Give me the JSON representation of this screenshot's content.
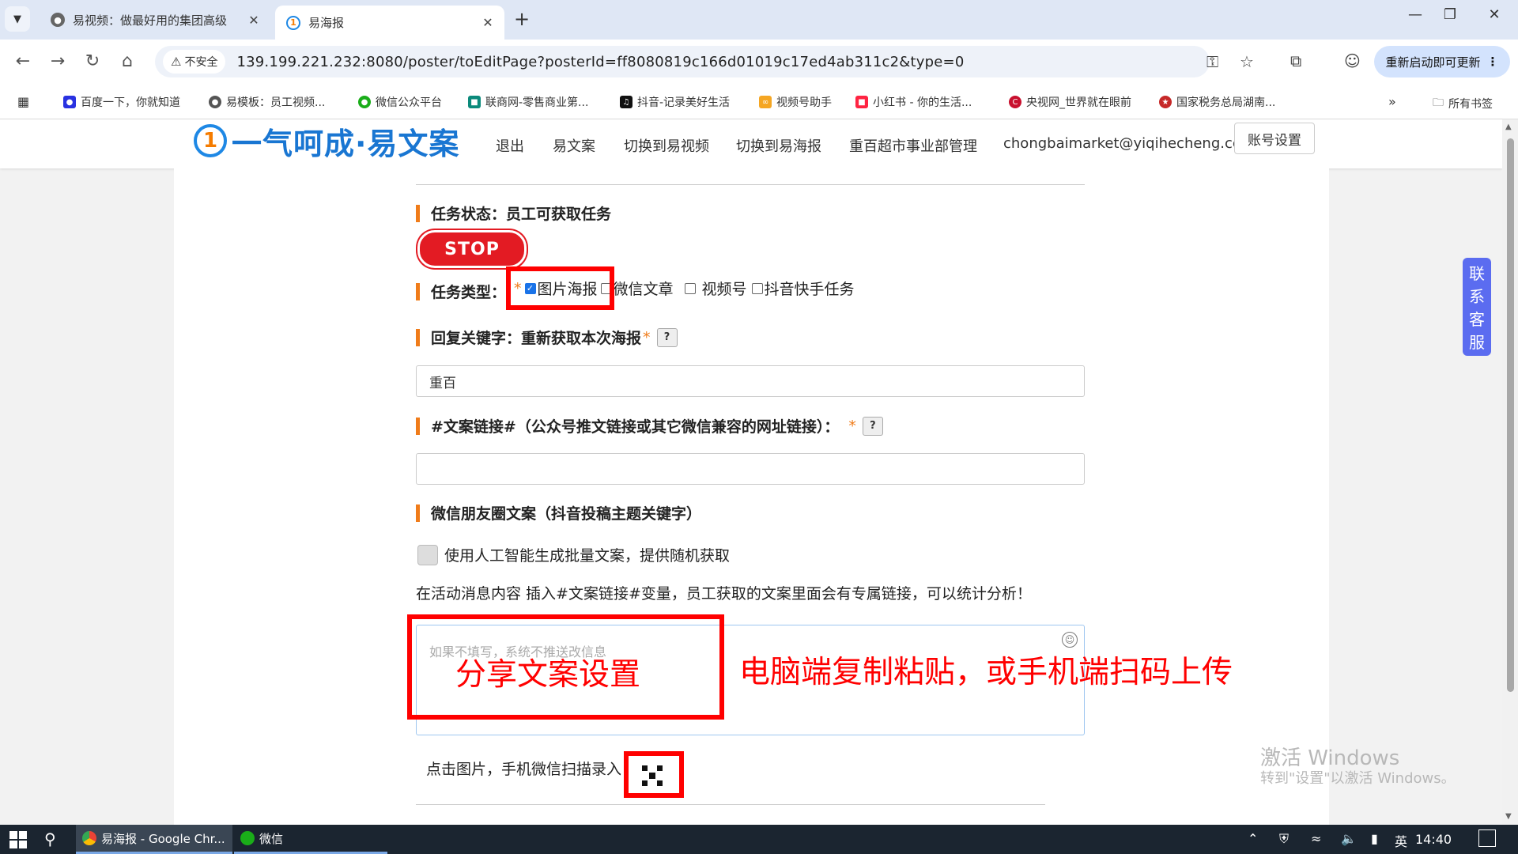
{
  "browser": {
    "tabs": [
      {
        "title": "易视频：做最好用的集团高级",
        "active": false
      },
      {
        "title": "易海报",
        "active": true
      }
    ],
    "address": {
      "security_label": "不安全",
      "url": "139.199.221.232:8080/poster/toEditPage?posterId=ff8080819c166d01019c17ed4ab311c2&type=0"
    },
    "update_button": "重新启动即可更新",
    "bookmarks": [
      "百度一下，你就知道",
      "易模板：员工视频...",
      "微信公众平台",
      "联商网-零售商业第...",
      "抖音-记录美好生活",
      "视频号助手",
      "小红书 - 你的生活...",
      "央视网_世界就在眼前",
      "国家税务总局湖南..."
    ],
    "all_bookmarks": "所有书签",
    "more_bookmarks": "»"
  },
  "header": {
    "logo_text": "一气呵成·易文案",
    "nav": [
      "退出",
      "易文案",
      "切换到易视频",
      "切换到易海报",
      "重百超市事业部管理",
      "chongbaimarket@yiqihecheng.cc"
    ],
    "account_button": "账号设置"
  },
  "form": {
    "status_label": "任务状态：员工可获取任务",
    "stop_button": "STOP",
    "type_label": "任务类型：",
    "type_options": [
      {
        "label": "图片海报",
        "checked": true
      },
      {
        "label": "微信文章",
        "checked": false
      },
      {
        "label": "视频号",
        "checked": false
      },
      {
        "label": "抖音快手任务",
        "checked": false
      }
    ],
    "keyword_label": "回复关键字：重新获取本次海报",
    "keyword_value": "重百",
    "link_label": "#文案链接#（公众号推文链接或其它微信兼容的网址链接）：",
    "link_value": "",
    "moments_label": "微信朋友圈文案（抖音投稿主题关键字）",
    "ai_label": "使用人工智能生成批量文案，提供随机获取",
    "hint": "在活动消息内容 插入#文案链接#变量，员工获取的文案里面会有专属链接，可以统计分析！",
    "textarea_placeholder": "如果不填写，系统不推送改信息",
    "scan_label": "点击图片，手机微信扫描录入"
  },
  "annotations": {
    "box_label": "分享文案设置",
    "note": "电脑端复制粘贴，或手机端扫码上传",
    "color": "#ff0000"
  },
  "contact": [
    "联",
    "系",
    "客",
    "服"
  ],
  "watermark": {
    "line1": "激活 Windows",
    "line2": "转到\"设置\"以激活 Windows。"
  },
  "taskbar": {
    "apps": [
      {
        "label": "易海报 - Google Chr...",
        "active": true
      },
      {
        "label": "微信",
        "active": false
      }
    ],
    "ime": "英",
    "time": "14:40"
  },
  "colors": {
    "accent": "#f07c1a",
    "stop": "#e31b23",
    "brand": "#1976d2"
  }
}
